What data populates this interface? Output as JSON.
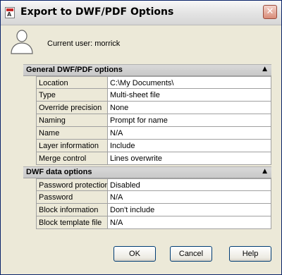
{
  "window": {
    "title": "Export to DWF/PDF Options"
  },
  "user": {
    "label": "Current user: morrick"
  },
  "sections": [
    {
      "title": "General DWF/PDF options",
      "rows": [
        {
          "key": "Location",
          "value": "C:\\My Documents\\"
        },
        {
          "key": "Type",
          "value": "Multi-sheet file"
        },
        {
          "key": "Override precision",
          "value": "None"
        },
        {
          "key": "Naming",
          "value": "Prompt for name"
        },
        {
          "key": "Name",
          "value": "N/A"
        },
        {
          "key": "Layer information",
          "value": "Include"
        },
        {
          "key": "Merge control",
          "value": "Lines overwrite"
        }
      ]
    },
    {
      "title": "DWF data options",
      "rows": [
        {
          "key": "Password protection",
          "value": "Disabled"
        },
        {
          "key": "Password",
          "value": "N/A"
        },
        {
          "key": "Block information",
          "value": "Don't include"
        },
        {
          "key": "Block template file",
          "value": "N/A"
        }
      ]
    }
  ],
  "buttons": {
    "ok": "OK",
    "cancel": "Cancel",
    "help": "Help"
  },
  "icons": {
    "app": "autocad-app-icon",
    "close": "close-icon",
    "user": "user-icon",
    "collapse": "collapse-arrow-icon"
  }
}
